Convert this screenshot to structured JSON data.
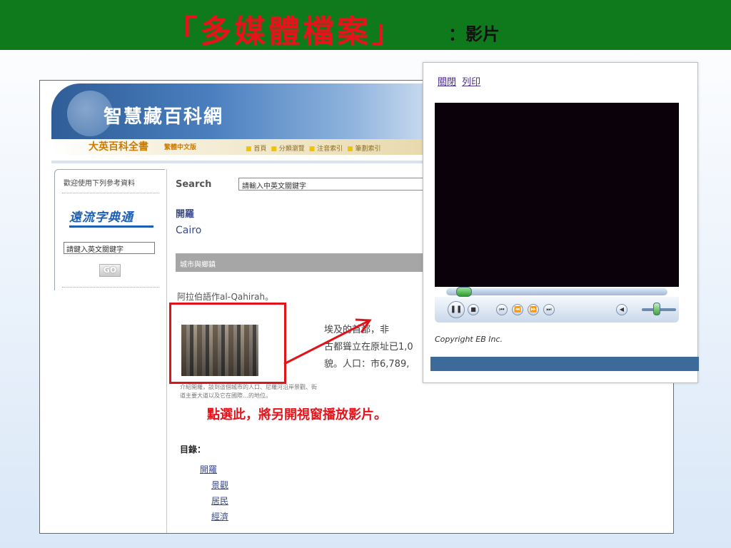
{
  "slide": {
    "title": "「多媒體檔案」",
    "subtitle": "：影片"
  },
  "site": {
    "title": "智慧藏百科網",
    "brand": "大英百科全書",
    "edition": "繁體中文版",
    "nav": [
      "首頁",
      "分類瀏覽",
      "注音索引",
      "筆劃索引"
    ]
  },
  "sidebar": {
    "intro": "歡迎使用下列參考資料",
    "dict_logo": "遠流字典通",
    "input_value": "請鍵入英文關鍵字",
    "go_label": "GO"
  },
  "search": {
    "label": "Search",
    "value": "請輸入中英文關鍵字"
  },
  "article": {
    "title": "開羅",
    "english": "Cairo",
    "category": "城市與鄉鎮",
    "alias": "阿拉伯語作al-Qahirah。",
    "body_lines": [
      "埃及的首都，非",
      "古都聳立在原址已1,0",
      "貌。人口：市6,789,"
    ],
    "caption": "介紹開羅，談到這個城市的人口、尼羅河沿岸景觀、街道主要大道以及它在國際…的地位。",
    "toc_title": "目錄：",
    "toc": [
      "開羅",
      "景觀",
      "居民",
      "經濟"
    ]
  },
  "annotation": {
    "note": "點選此，將另開視窗播放影片。"
  },
  "popup": {
    "close_label": "關閉",
    "print_label": "列印",
    "copyright": "Copyright EB Inc."
  },
  "colors": {
    "top_bar": "#0e7a1c",
    "title_red": "#e8121a",
    "link_blue": "#3a4a8c",
    "popup_footer": "#3c6b99"
  }
}
